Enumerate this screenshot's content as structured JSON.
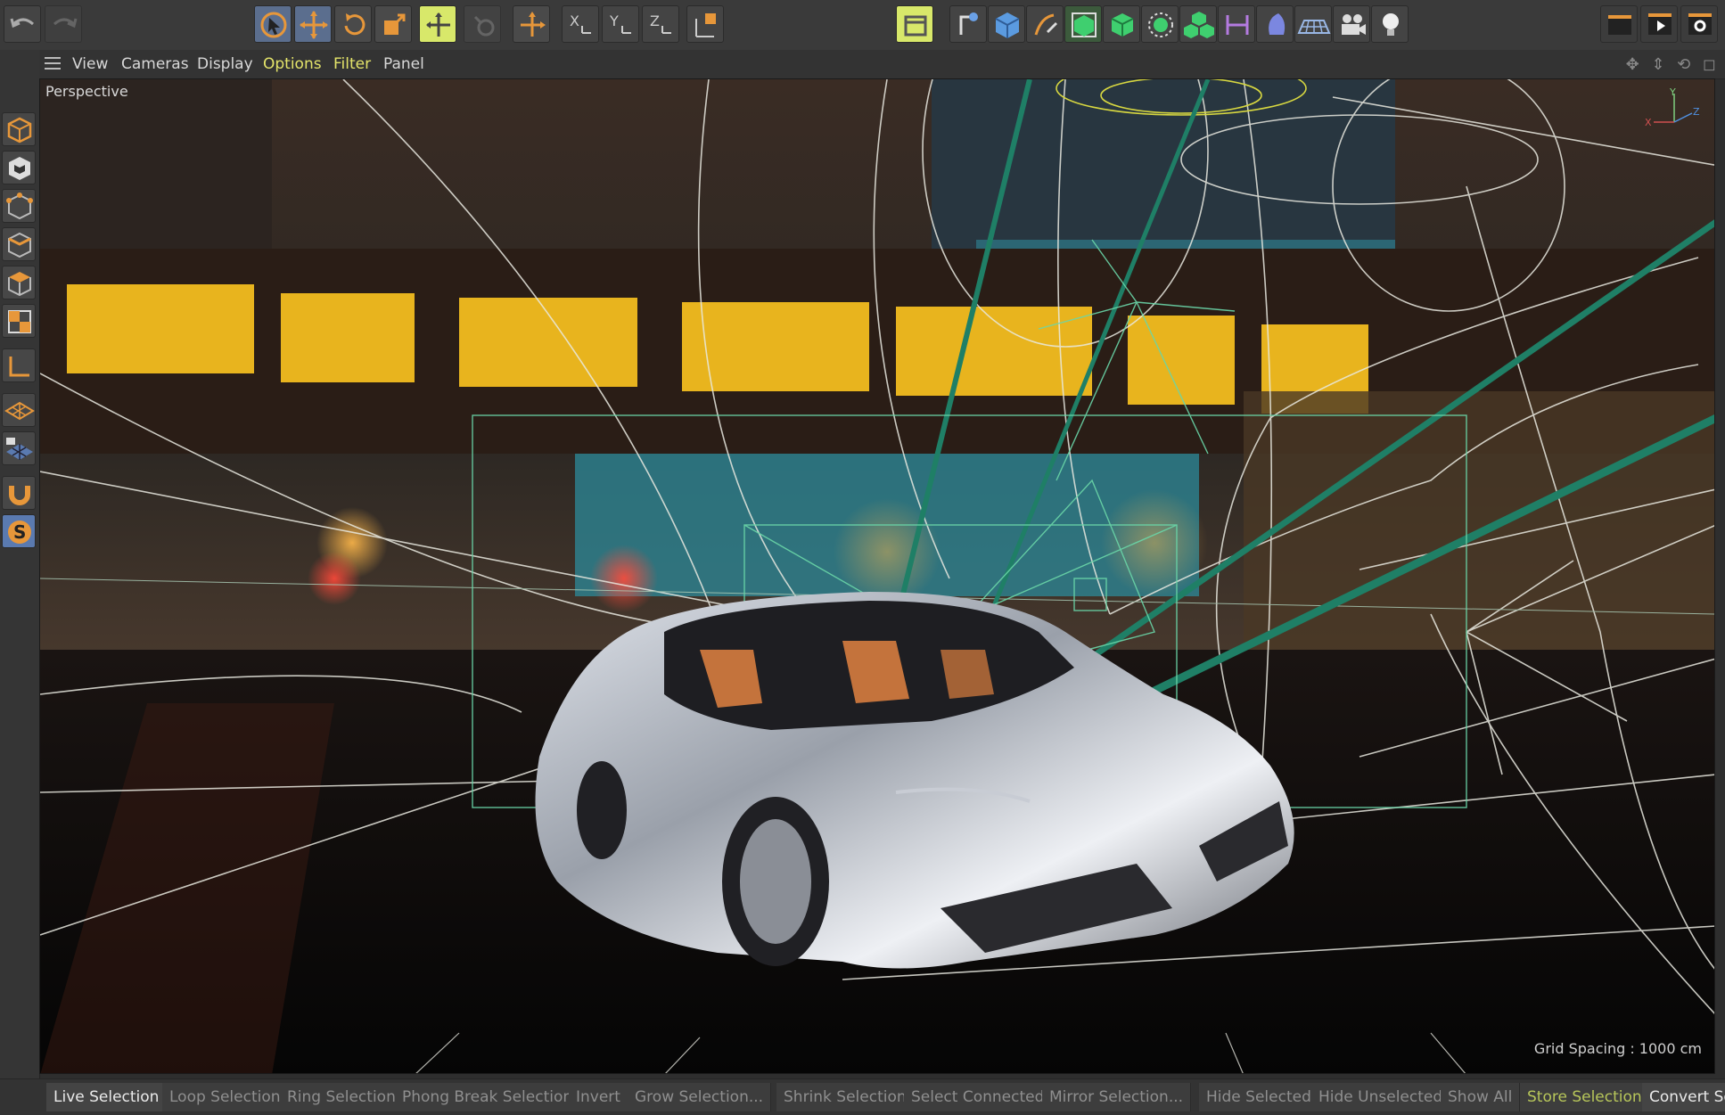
{
  "menu": {
    "items": [
      "View",
      "Cameras",
      "Display",
      "Options",
      "Filter",
      "Panel"
    ]
  },
  "viewport": {
    "label": "Perspective",
    "grid_spacing": "Grid Spacing : 1000 cm",
    "axis_labels": {
      "x": "X",
      "y": "Y",
      "z": "Z"
    }
  },
  "toolbar": {
    "axis_x": "X",
    "axis_y": "Y",
    "axis_z": "Z",
    "icons": [
      "undo-icon",
      "redo-icon",
      "live-selection-icon",
      "move-icon",
      "rotate-icon",
      "scale-icon",
      "transform-icon",
      "recent-tool-icon",
      "axis-icon",
      "x-axis-lock-icon",
      "y-axis-lock-icon",
      "z-axis-lock-icon",
      "coordinate-system-icon",
      "model-mode-icon",
      "pen-icon",
      "cube-icon",
      "spline-pen-icon",
      "subdivision-icon",
      "extrude-icon",
      "array-icon",
      "cloner-icon",
      "symmetry-icon",
      "deformer-icon",
      "floor-icon",
      "camera-icon",
      "light-icon",
      "render-view-icon",
      "render-picture-icon",
      "render-settings-icon"
    ]
  },
  "colors": {
    "accent_orange": "#e7973a",
    "accent_yellow": "#e4e46a",
    "accent_blue": "#5a7ab0",
    "wire_green": "#3fbf8f"
  },
  "commands": [
    "Live Selection",
    "Loop Selection",
    "Ring Selection",
    "Phong Break Selection",
    "Invert",
    "Grow Selection...",
    "Shrink Selection",
    "Select Connected",
    "Mirror Selection...",
    "Hide Selected",
    "Hide Unselected",
    "Show All",
    "Store Selection",
    "Convert Se"
  ]
}
